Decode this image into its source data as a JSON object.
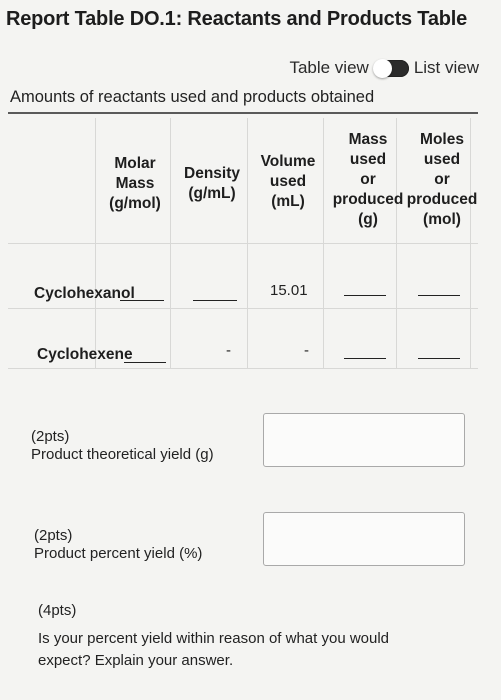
{
  "title": "Report Table DO.1: Reactants and Products Table",
  "toggle": {
    "left_label": "Table view",
    "right_label": "List view"
  },
  "caption": "Amounts of reactants used and products obtained",
  "headers": {
    "molar_mass": [
      "Molar",
      "Mass",
      "(g/mol)"
    ],
    "density": [
      "Density",
      "(g/mL)"
    ],
    "volume": [
      "Volume",
      "used",
      "(mL)"
    ],
    "mass": [
      "Mass",
      "used",
      "or",
      "produced",
      "(g)"
    ],
    "moles": [
      "Moles",
      "used",
      "or",
      "produced",
      "(mol)"
    ]
  },
  "rows": [
    {
      "label": "Cyclohexanol",
      "volume": "15.01"
    },
    {
      "label": "Cyclohexene",
      "density": "-",
      "volume": "-"
    }
  ],
  "questions": [
    {
      "points": "(2pts)",
      "text": "Product theoretical yield (g)"
    },
    {
      "points": "(2pts)",
      "text": "Product percent yield (%)"
    },
    {
      "points": "(4pts)",
      "text_line1": "Is your percent yield within reason of what you would",
      "text_line2": "expect? Explain your answer."
    }
  ]
}
